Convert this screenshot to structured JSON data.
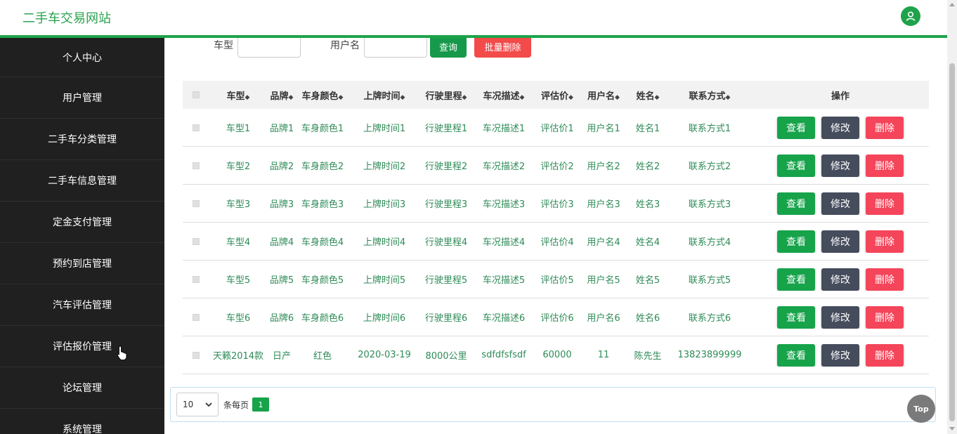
{
  "header": {
    "title": "二手车交易网站",
    "avatar_icon": "user-icon"
  },
  "sidebar": {
    "items": [
      {
        "label": "个人中心"
      },
      {
        "label": "用户管理"
      },
      {
        "label": "二手车分类管理"
      },
      {
        "label": "二手车信息管理"
      },
      {
        "label": "定金支付管理"
      },
      {
        "label": "预约到店管理"
      },
      {
        "label": "汽车评估管理"
      },
      {
        "label": "评估报价管理"
      },
      {
        "label": "论坛管理"
      },
      {
        "label": "系统管理"
      }
    ]
  },
  "search": {
    "car_type_label": "车型",
    "username_label": "用户名",
    "query_label": "查询",
    "batch_delete_label": "批量删除"
  },
  "table": {
    "headers": [
      "车型",
      "品牌",
      "车身颜色",
      "上牌时间",
      "行驶里程",
      "车况描述",
      "评估价",
      "用户名",
      "姓名",
      "联系方式"
    ],
    "actions_header": "操作",
    "sort_icon": "◆",
    "rows": [
      [
        "车型1",
        "品牌1",
        "车身颜色1",
        "上牌时间1",
        "行驶里程1",
        "车况描述1",
        "评估价1",
        "用户名1",
        "姓名1",
        "联系方式1"
      ],
      [
        "车型2",
        "品牌2",
        "车身颜色2",
        "上牌时间2",
        "行驶里程2",
        "车况描述2",
        "评估价2",
        "用户名2",
        "姓名2",
        "联系方式2"
      ],
      [
        "车型3",
        "品牌3",
        "车身颜色3",
        "上牌时间3",
        "行驶里程3",
        "车况描述3",
        "评估价3",
        "用户名3",
        "姓名3",
        "联系方式3"
      ],
      [
        "车型4",
        "品牌4",
        "车身颜色4",
        "上牌时间4",
        "行驶里程4",
        "车况描述4",
        "评估价4",
        "用户名4",
        "姓名4",
        "联系方式4"
      ],
      [
        "车型5",
        "品牌5",
        "车身颜色5",
        "上牌时间5",
        "行驶里程5",
        "车况描述5",
        "评估价5",
        "用户名5",
        "姓名5",
        "联系方式5"
      ],
      [
        "车型6",
        "品牌6",
        "车身颜色6",
        "上牌时间6",
        "行驶里程6",
        "车况描述6",
        "评估价6",
        "用户名6",
        "姓名6",
        "联系方式6"
      ],
      [
        "天籁2014款",
        "日产",
        "红色",
        "2020-03-19",
        "8000公里",
        "sdfdfsfsdf",
        "60000",
        "11",
        "陈先生",
        "13823899999"
      ]
    ],
    "view_label": "查看",
    "edit_label": "修改",
    "delete_label": "删除"
  },
  "pagination": {
    "page_size": "10",
    "per_page_label": "条每页",
    "current_page": "1"
  },
  "top_button": "Top",
  "colors": {
    "accent": "#1ea34b",
    "sidebar_bg": "#202020",
    "text_green": "#2e8b57",
    "danger": "#f4455a",
    "dark_btn": "#454c5c"
  }
}
